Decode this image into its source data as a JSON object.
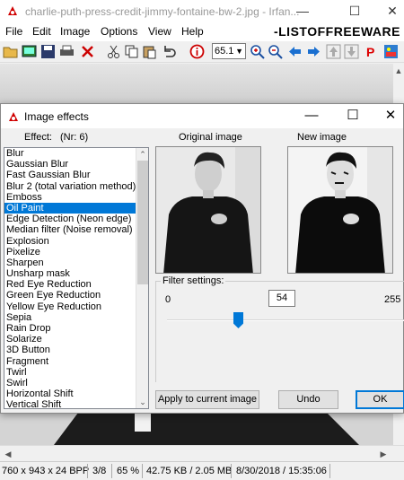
{
  "window": {
    "title": "charlie-puth-press-credit-jimmy-fontaine-bw-2.jpg - Irfan...",
    "minimize": "—",
    "maximize": "☐",
    "close": "✕"
  },
  "menu": [
    "File",
    "Edit",
    "Image",
    "Options",
    "View",
    "Help"
  ],
  "watermark": "-LISTOFFREEWARE",
  "toolbar": {
    "zoom_value": "65.1",
    "icons": [
      "open-folder-icon",
      "thumbnails-icon",
      "save-icon",
      "print-icon",
      "delete-icon",
      "cut-icon",
      "copy-icon",
      "paste-icon",
      "undo-icon",
      "info-icon",
      "zoom-in-icon",
      "zoom-out-icon",
      "previous-icon",
      "next-icon",
      "first-icon",
      "last-icon",
      "paypal-icon",
      "settings-icon"
    ]
  },
  "status": {
    "dimensions": "760 x 943 x 24 BPP",
    "index": "3/8",
    "zoom": "65 %",
    "size": "42.75 KB / 2.05 MB",
    "datetime": "8/30/2018 / 15:35:06"
  },
  "dialog": {
    "title": "Image effects",
    "effect_label": "Effect:",
    "effect_number": "(Nr: 6)",
    "original_label": "Original image",
    "new_label": "New image",
    "filter_label": "Filter settings:",
    "slider_min": "0",
    "slider_value": "54",
    "slider_max": "255",
    "slider_fraction": 0.212,
    "apply_button": "Apply to current image",
    "undo_button": "Undo",
    "ok_button": "OK",
    "effects": [
      "Blur",
      "Gaussian Blur",
      "Fast Gaussian Blur",
      "Blur 2 (total variation method)",
      "Emboss",
      "Oil Paint",
      "Edge Detection (Neon edge)",
      "Median filter (Noise removal)",
      "Explosion",
      "Pixelize",
      "Sharpen",
      "Unsharp mask",
      "Red Eye Reduction",
      "Green Eye Reduction",
      "Yellow Eye Reduction",
      "Sepia",
      "Rain Drop",
      "Solarize",
      "3D Button",
      "Fragment",
      "Twirl",
      "Swirl",
      "Horizontal Shift",
      "Vertical Shift"
    ],
    "selected_index": 5
  },
  "colors": {
    "accent": "#0078d7",
    "stop_red": "#d00000"
  }
}
